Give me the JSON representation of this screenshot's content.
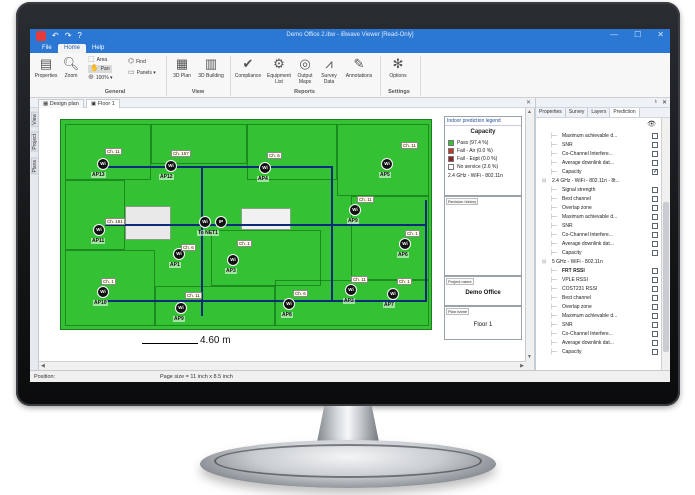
{
  "window": {
    "title": "Demo Office 2.ibw - iBwave Viewer [Read-Only]",
    "app_logo": "app-logo-icon"
  },
  "menu": {
    "items": [
      "File",
      "Home",
      "Help"
    ],
    "active": "Home"
  },
  "ribbon": {
    "general": {
      "label": "General",
      "properties": "Properties",
      "zoom": "Zoom",
      "area": "Area",
      "pan": "Pan",
      "zoom_level": "100%",
      "find": "Find",
      "panels": "Panels"
    },
    "view": {
      "label": "View",
      "plan3d": "3D Plan",
      "building3d": "3D Building"
    },
    "reports": {
      "label": "Reports",
      "compliance": "Compliance",
      "equipment": "Equipment List",
      "output_maps": "Output Maps",
      "survey": "Survey Data",
      "annotations": "Annotations"
    },
    "settings": {
      "label": "Settings",
      "options": "Options"
    }
  },
  "doc_tabs": [
    "Design plan",
    "Floor 1"
  ],
  "side_tabs": [
    "View",
    "Project",
    "Plans"
  ],
  "plan": {
    "aps": [
      {
        "id": "AP1",
        "label": "Ch. 6"
      },
      {
        "id": "AP2",
        "label": "Ch. 11"
      },
      {
        "id": "AP3",
        "label": "Ch. 1"
      },
      {
        "id": "AP4",
        "label": "Ch. 6"
      },
      {
        "id": "AP5",
        "label": "Ch. 11"
      },
      {
        "id": "AP6",
        "label": "Ch. 1"
      },
      {
        "id": "AP7",
        "label": "Ch. 1"
      },
      {
        "id": "AP8",
        "label": "Ch. 6"
      },
      {
        "id": "AP9",
        "label": "Ch. 11"
      },
      {
        "id": "AP10",
        "label": "Ch. 1"
      },
      {
        "id": "AP11",
        "label": "Ch. 161"
      },
      {
        "id": "AP12",
        "label": "Ch. 157"
      },
      {
        "id": "AP13",
        "label": "Ch. 11"
      }
    ],
    "network": "To NET1",
    "center_tag": "IP",
    "scale": "4.60 m"
  },
  "legend": {
    "header": "Indoor prediction legend",
    "title": "Capacity",
    "items": [
      {
        "label": "Pass (97.4 %)",
        "color": "#38c038"
      },
      {
        "label": "Fail - Air (0.0 %)",
        "color": "#c0392b"
      },
      {
        "label": "Fail - Eqpt (0.0 %)",
        "color": "#8e2424"
      },
      {
        "label": "No service (2.6 %)",
        "color": "#ffffff"
      }
    ],
    "footer": "2.4 GHz - WiFi - 802.11n"
  },
  "title_block": {
    "revision_tag": "Revision history",
    "project_tag": "Project name",
    "project_name": "Demo Office",
    "plan_tag": "Plan name",
    "plan_name": "Floor 1"
  },
  "right_panel": {
    "tabs": [
      "Properties",
      "Survey",
      "Layers",
      "Prediction"
    ],
    "active_tab": "Prediction",
    "rows": [
      {
        "text": "Maximum achievable d...",
        "indent": 2,
        "checked": false,
        "bold": false
      },
      {
        "text": "SNR",
        "indent": 2,
        "checked": false,
        "bold": false
      },
      {
        "text": "Co-Channel Interfere...",
        "indent": 2,
        "checked": false,
        "bold": false
      },
      {
        "text": "Average downlink dat...",
        "indent": 2,
        "checked": false,
        "bold": false
      },
      {
        "text": "Capacity",
        "indent": 2,
        "checked": true,
        "bold": false
      },
      {
        "text": "2.4 GHz - WiFi - 802.11n - 8t...",
        "indent": 1,
        "checked": false,
        "bold": false
      },
      {
        "text": "Signal strength",
        "indent": 2,
        "checked": false,
        "bold": false
      },
      {
        "text": "Best channel",
        "indent": 2,
        "checked": false,
        "bold": false
      },
      {
        "text": "Overlap zone",
        "indent": 2,
        "checked": false,
        "bold": false
      },
      {
        "text": "Maximum achievable d...",
        "indent": 2,
        "checked": false,
        "bold": false
      },
      {
        "text": "SNR",
        "indent": 2,
        "checked": false,
        "bold": false
      },
      {
        "text": "Co-Channel Interfere...",
        "indent": 2,
        "checked": false,
        "bold": false
      },
      {
        "text": "Average downlink dat...",
        "indent": 2,
        "checked": false,
        "bold": false
      },
      {
        "text": "Capacity",
        "indent": 2,
        "checked": false,
        "bold": false
      },
      {
        "text": "5 GHz - WiFi - 802.11n",
        "indent": 1,
        "checked": false,
        "bold": false
      },
      {
        "text": "FRT RSSI",
        "indent": 2,
        "checked": false,
        "bold": true
      },
      {
        "text": "VPLE RSSI",
        "indent": 2,
        "checked": false,
        "bold": false
      },
      {
        "text": "COST231 RSSI",
        "indent": 2,
        "checked": false,
        "bold": false
      },
      {
        "text": "Best channel",
        "indent": 2,
        "checked": false,
        "bold": false
      },
      {
        "text": "Overlap zone",
        "indent": 2,
        "checked": false,
        "bold": false
      },
      {
        "text": "Maximum achievable d...",
        "indent": 2,
        "checked": false,
        "bold": false
      },
      {
        "text": "SNR",
        "indent": 2,
        "checked": false,
        "bold": false
      },
      {
        "text": "Co-Channel Interfere...",
        "indent": 2,
        "checked": false,
        "bold": false
      },
      {
        "text": "Average downlink dat...",
        "indent": 2,
        "checked": false,
        "bold": false
      },
      {
        "text": "Capacity",
        "indent": 2,
        "checked": false,
        "bold": false
      }
    ]
  },
  "status": {
    "position": "Position:",
    "page_size": "Page size = 11 inch x 8.5 inch"
  },
  "colors": {
    "accent": "#2b78d4",
    "coverage": "#34c234",
    "cable": "#0c2a7a"
  }
}
